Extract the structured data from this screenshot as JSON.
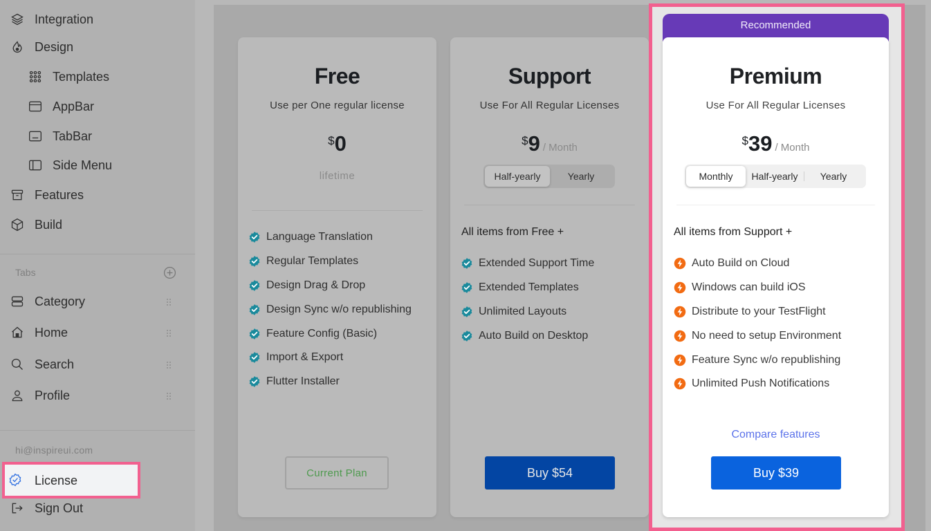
{
  "sidebar": {
    "nav": [
      {
        "label": "Integration",
        "icon": "layers-icon"
      },
      {
        "label": "Design",
        "icon": "design-icon"
      },
      {
        "label": "Templates",
        "icon": "grid-dots-icon"
      },
      {
        "label": "AppBar",
        "icon": "appbar-icon"
      },
      {
        "label": "TabBar",
        "icon": "tabbar-icon"
      },
      {
        "label": "Side Menu",
        "icon": "side-menu-icon"
      },
      {
        "label": "Features",
        "icon": "archive-icon"
      },
      {
        "label": "Build",
        "icon": "cube-icon"
      }
    ],
    "tabs_label": "Tabs",
    "tabs": [
      {
        "label": "Category",
        "icon": "category-icon"
      },
      {
        "label": "Home",
        "icon": "home-icon"
      },
      {
        "label": "Search",
        "icon": "search-icon"
      },
      {
        "label": "Profile",
        "icon": "user-icon"
      }
    ],
    "email": "hi@inspireui.com",
    "license_label": "License",
    "signout_label": "Sign Out"
  },
  "plans": {
    "free": {
      "title": "Free",
      "subtitle": "Use per One regular license",
      "currency": "$",
      "price": "0",
      "period_note": "lifetime",
      "features": [
        "Language Translation",
        "Regular Templates",
        "Design Drag & Drop",
        "Design Sync w/o republishing",
        "Feature Config (Basic)",
        "Import & Export",
        "Flutter Installer"
      ],
      "button": "Current Plan"
    },
    "support": {
      "title": "Support",
      "subtitle": "Use For All Regular Licenses",
      "currency": "$",
      "price": "9",
      "per": "/ Month",
      "billing_options": [
        "Half-yearly",
        "Yearly"
      ],
      "billing_selected": "Half-yearly",
      "features_heading": "All items from Free  +",
      "features": [
        "Extended Support Time",
        "Extended Templates",
        "Unlimited Layouts",
        "Auto Build on Desktop"
      ],
      "button": "Buy $54"
    },
    "premium": {
      "badge": "Recommended",
      "title": "Premium",
      "subtitle": "Use For All Regular Licenses",
      "currency": "$",
      "price": "39",
      "per": "/ Month",
      "billing_options": [
        "Monthly",
        "Half-yearly",
        "Yearly"
      ],
      "billing_selected": "Monthly",
      "features_heading": "All items from Support  +",
      "features": [
        "Auto Build on Cloud",
        "Windows can build iOS",
        "Distribute to your TestFlight",
        "No need to setup Environment",
        "Feature Sync w/o republishing",
        "Unlimited Push Notifications"
      ],
      "compare_link": "Compare features",
      "button": "Buy $39"
    }
  },
  "colors": {
    "highlight": "#f2608f",
    "badge": "#673ab7",
    "primary_button": "#0a63de",
    "check_icon": "#1a9cb0",
    "bolt_icon": "#f26b12",
    "link": "#5b72ea",
    "current_plan_text": "#4e9a4e"
  }
}
